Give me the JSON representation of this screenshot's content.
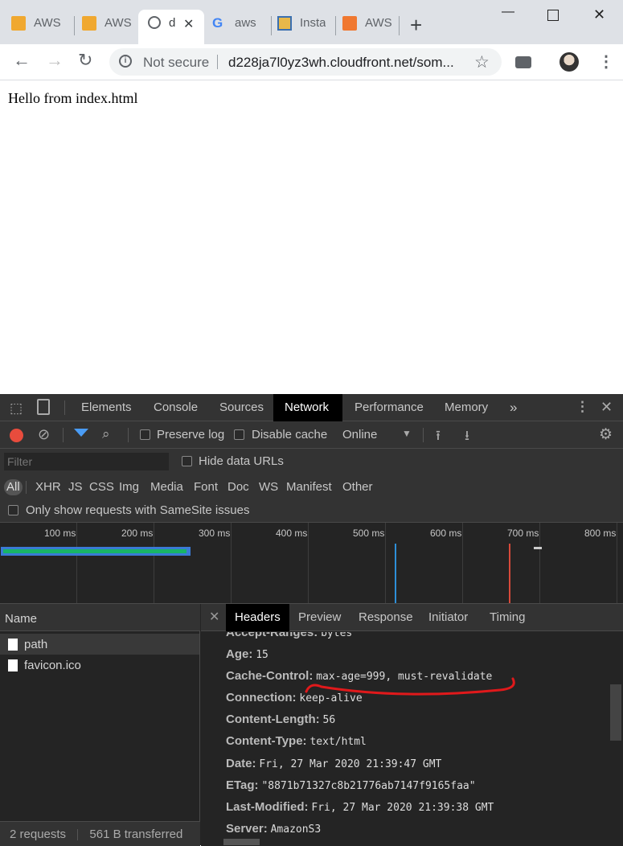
{
  "browser": {
    "tabs": [
      {
        "label": "AWS"
      },
      {
        "label": "AWS"
      },
      {
        "label": "d"
      },
      {
        "label": "aws"
      },
      {
        "label": "Insta"
      },
      {
        "label": "AWS"
      }
    ],
    "omnibox": {
      "security_label": "Not secure",
      "url": "d228ja7l0yz3wh.cloudfront.net/som..."
    }
  },
  "page": {
    "body_text": "Hello from index.html"
  },
  "devtools": {
    "tabs": [
      "Elements",
      "Console",
      "Sources",
      "Network",
      "Performance",
      "Memory"
    ],
    "active_tab": "Network",
    "more_tabs": "»",
    "toolbar": {
      "preserve_log": "Preserve log",
      "disable_cache": "Disable cache",
      "throttling": "Online"
    },
    "filter": {
      "placeholder": "Filter",
      "hide_data_urls": "Hide data URLs"
    },
    "types": [
      "All",
      "XHR",
      "JS",
      "CSS",
      "Img",
      "Media",
      "Font",
      "Doc",
      "WS",
      "Manifest",
      "Other"
    ],
    "samesite": "Only show requests with SameSite issues",
    "timeline_ticks": [
      "100 ms",
      "200 ms",
      "300 ms",
      "400 ms",
      "500 ms",
      "600 ms",
      "700 ms",
      "800 ms"
    ],
    "requests": {
      "header": "Name",
      "rows": [
        "path",
        "favicon.ico"
      ],
      "status_requests": "2 requests",
      "status_transferred": "561 B transferred"
    },
    "detail": {
      "tabs": [
        "Headers",
        "Preview",
        "Response",
        "Initiator",
        "Timing"
      ],
      "active_tab": "Headers",
      "headers": [
        {
          "key": "Accept-Ranges:",
          "value": "bytes"
        },
        {
          "key": "Age:",
          "value": "15"
        },
        {
          "key": "Cache-Control:",
          "value": "max-age=999, must-revalidate"
        },
        {
          "key": "Connection:",
          "value": "keep-alive"
        },
        {
          "key": "Content-Length:",
          "value": "56"
        },
        {
          "key": "Content-Type:",
          "value": "text/html"
        },
        {
          "key": "Date:",
          "value": "Fri, 27 Mar 2020 21:39:47 GMT"
        },
        {
          "key": "ETag:",
          "value": "\"8871b71327c8b21776ab7147f9165faa\""
        },
        {
          "key": "Last-Modified:",
          "value": "Fri, 27 Mar 2020 21:39:38 GMT"
        },
        {
          "key": "Server:",
          "value": "AmazonS3"
        }
      ]
    }
  }
}
